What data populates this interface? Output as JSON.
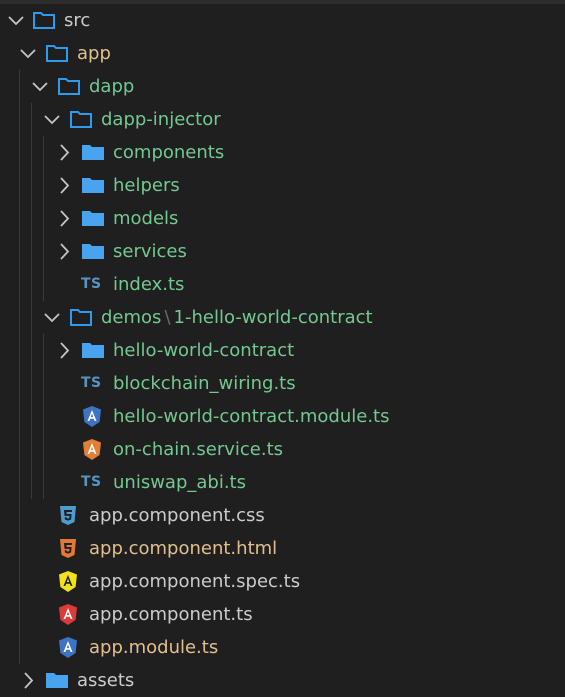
{
  "colors": {
    "folder_outline": "#2d9bf0",
    "folder_filled": "#4aa3ef",
    "modified_green": "#73c991",
    "untracked_yellow": "#e2c08d",
    "angular_blue": "#3f74c4",
    "angular_orange": "#e07f35",
    "angular_yellow": "#f0e21d",
    "angular_red": "#dd3a3a",
    "html_orange": "#e37933",
    "css_blue": "#4c9ccf",
    "ts_badge": "#5893c6"
  },
  "tree": {
    "src": "src",
    "app": "app",
    "dapp": "dapp",
    "dapp_injector": "dapp-injector",
    "components": "components",
    "helpers": "helpers",
    "models": "models",
    "services": "services",
    "index_ts": "index.ts",
    "demos_part1": "demos",
    "demos_sep": "\\",
    "demos_part2": "1-hello-world-contract",
    "hello_world_contract": "hello-world-contract",
    "blockchain_wiring": "blockchain_wiring.ts",
    "hello_world_module": "hello-world-contract.module.ts",
    "on_chain_service": "on-chain.service.ts",
    "uniswap_abi": "uniswap_abi.ts",
    "app_component_css": "app.component.css",
    "app_component_html": "app.component.html",
    "app_component_spec": "app.component.spec.ts",
    "app_component_ts": "app.component.ts",
    "app_module_ts": "app.module.ts",
    "assets": "assets"
  },
  "icon_text": {
    "ts": "TS"
  }
}
